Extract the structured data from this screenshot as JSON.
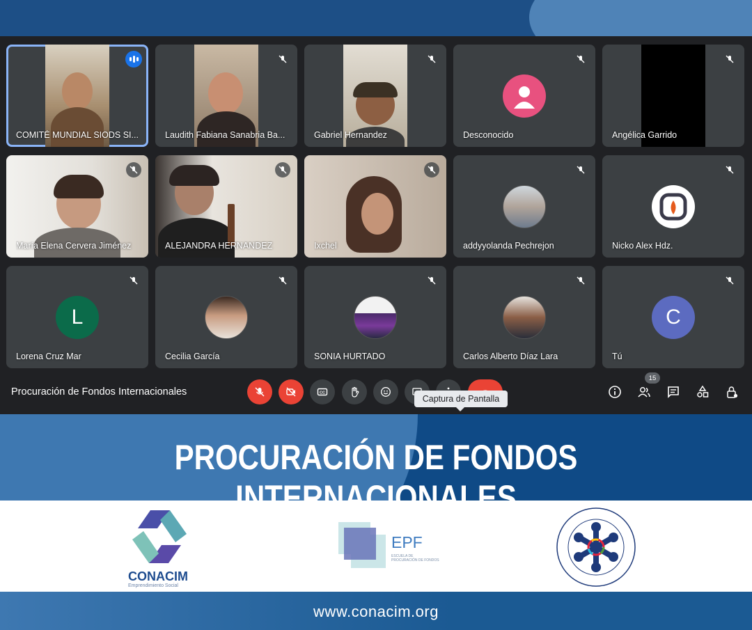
{
  "meeting": {
    "title": "Procuración de Fondos Internacionales",
    "tooltip": "Captura de Pantalla",
    "participant_count": "15"
  },
  "participants": [
    {
      "name": "COMITÉ MUNDIAL SIODS SI...",
      "state": "speaking"
    },
    {
      "name": "Laudith Fabiana Sanabria Ba...",
      "state": "muted"
    },
    {
      "name": "Gabriel Hernandez",
      "state": "muted"
    },
    {
      "name": "Desconocido",
      "state": "muted",
      "avatar": "person-icon",
      "avatar_color": "#e8517f"
    },
    {
      "name": "Angélica Garrido",
      "state": "muted"
    },
    {
      "name": "María Elena Cervera Jiménez",
      "state": "muted"
    },
    {
      "name": "ALEJANDRA HERNANDEZ",
      "state": "muted"
    },
    {
      "name": "Ixchel",
      "state": "muted"
    },
    {
      "name": "addyyolanda Pechrejon",
      "state": "muted"
    },
    {
      "name": "Nicko Alex Hdz.",
      "state": "muted"
    },
    {
      "name": "Lorena Cruz Mar",
      "state": "muted",
      "avatar_letter": "L",
      "avatar_color": "#0b6b4a"
    },
    {
      "name": "Cecilia García",
      "state": "muted"
    },
    {
      "name": "SONIA HURTADO",
      "state": "muted"
    },
    {
      "name": "Carlos Alberto Díaz Lara",
      "state": "muted"
    },
    {
      "name": "Tú",
      "state": "muted",
      "avatar_letter": "C",
      "avatar_color": "#5c6bc0"
    }
  ],
  "controls": [
    "mic-off-icon",
    "camera-off-icon",
    "captions-icon",
    "raise-hand-icon",
    "emoji-icon",
    "present-icon",
    "more-icon",
    "end-call-icon"
  ],
  "side_controls": [
    "info-icon",
    "people-icon",
    "chat-icon",
    "activities-icon",
    "host-controls-icon"
  ],
  "promo": {
    "headline": "PROCURACIÓN DE FONDOS INTERNACIONALES",
    "logo1": {
      "name": "CONACIM",
      "sub": "Emprendimiento Social"
    },
    "logo2": {
      "name": "EPF",
      "sub": "ESCUELA DE PROCURACIÓN DE FONDOS"
    },
    "logo3": {
      "ring_text": "COMITÉ MUNDIAL DE SEGUIMIENTO E IMPLEMENTACIÓN DE OBJETIVOS DE DESARROLLO SOSTENIBLE"
    },
    "url": "www.conacim.org"
  },
  "colors": {
    "meet_bg": "#202124",
    "tile_bg": "#3c4043",
    "danger": "#ea4335",
    "active_border": "#8ab4f8",
    "brand_blue": "#1d4f86"
  }
}
